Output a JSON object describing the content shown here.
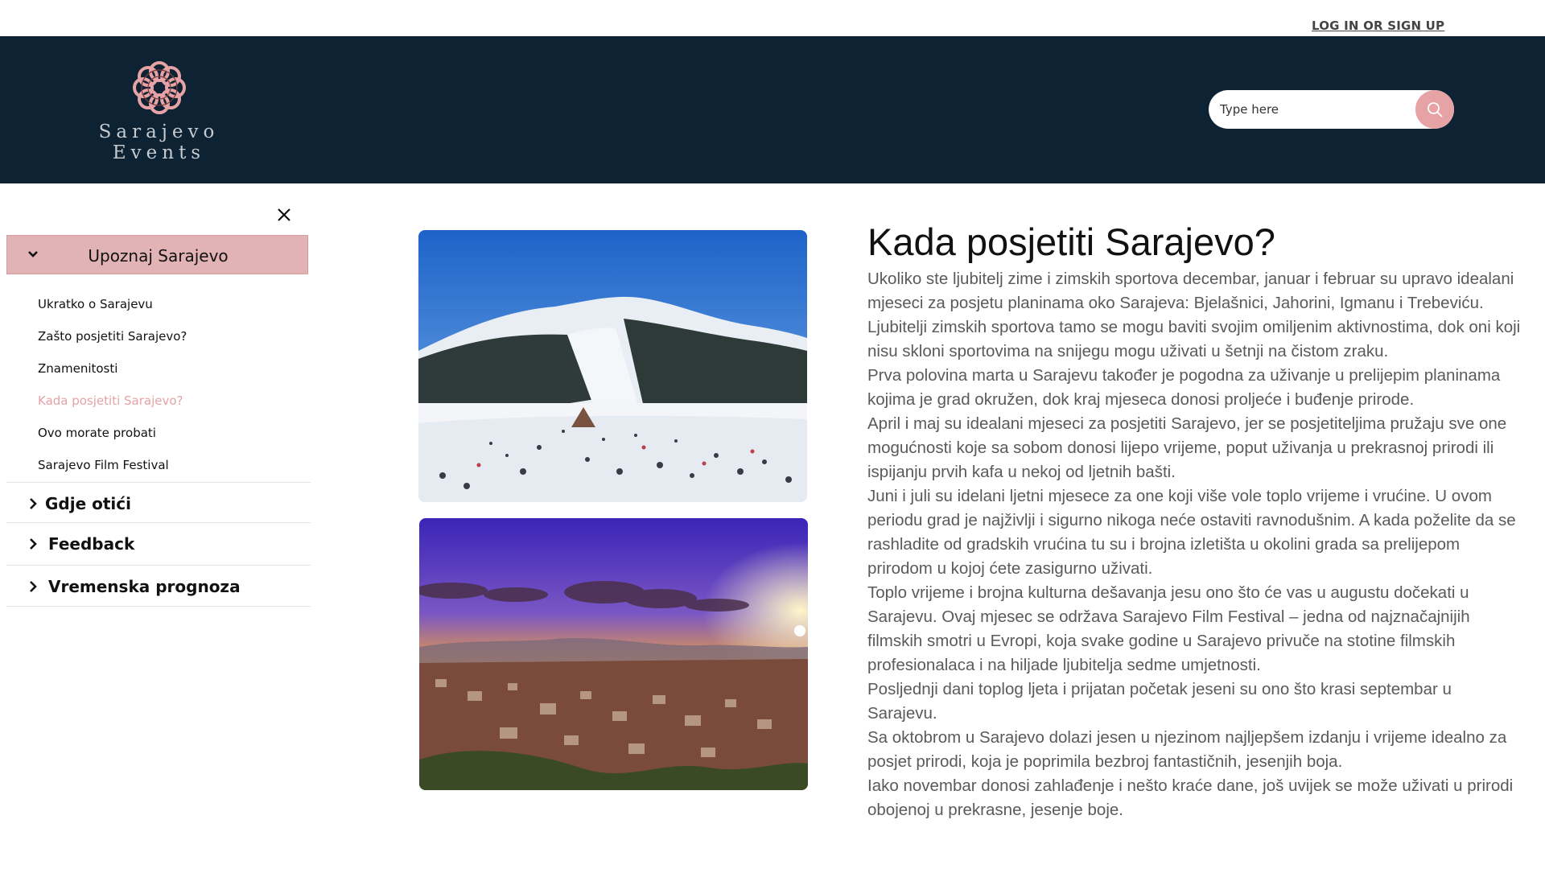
{
  "auth": {
    "login_label": "LOG IN OR SIGN UP"
  },
  "brand": {
    "line1": "Sarajevo",
    "line2": "Events",
    "accent_color": "#e6a2a4",
    "header_bg": "#0d2233"
  },
  "search": {
    "placeholder": "Type here",
    "button_icon": "search-icon"
  },
  "sidebar": {
    "close_icon": "close-icon",
    "active_section": {
      "label": "Upoznaj Sarajevo",
      "items": [
        {
          "label": "Ukratko o Sarajevu",
          "active": false
        },
        {
          "label": "Zašto posjetiti Sarajevo?",
          "active": false
        },
        {
          "label": "Znamenitosti",
          "active": false
        },
        {
          "label": "Kada posjetiti Sarajevo?",
          "active": true
        },
        {
          "label": "Ovo morate probati",
          "active": false
        },
        {
          "label": "Sarajevo Film Festival",
          "active": false
        }
      ]
    },
    "sections": [
      {
        "label": "Gdje otići"
      },
      {
        "label": "Feedback"
      },
      {
        "label": "Vremenska prognoza"
      }
    ]
  },
  "main": {
    "title": "Kada posjetiti Sarajevo?",
    "paragraphs": [
      "Ukoliko ste ljubitelj zime i zimskih sportova decembar, januar i februar su upravo idealani mjeseci za posjetu planinama oko Sarajeva: Bjelašnici, Jahorini, Igmanu i Trebeviću. Ljubitelji zimskih sportova tamo se mogu baviti svojim omiljenim aktivnostima, dok oni koji nisu skloni sportovima na snijegu mogu uživati u šetnji na čistom zraku.",
      "Prva polovina marta u Sarajevu također je pogodna za uživanje u prelijepim planinama kojima je grad okružen, dok kraj mjeseca donosi proljeće i buđenje prirode.",
      "April i maj su idealani mjeseci za posjetiti Sarajevo, jer se posjetiteljima pružaju sve one mogućnosti koje sa sobom donosi lijepo vrijeme, poput uživanja u prekrasnoj prirodi ili ispijanju prvih kafa u nekoj od ljetnih bašti.",
      "Juni i juli su idelani ljetni mjesece za one koji više vole toplo vrijeme i vrućine. U ovom periodu grad je najživlji i sigurno nikoga neće ostaviti ravnodušnim. A kada poželite da se rashladite od gradskih vrućina tu su i brojna izletišta u okolini grada sa prelijepom prirodom u kojoj ćete zasigurno uživati.",
      "Toplo vrijeme i brojna kulturna dešavanja jesu ono što će vas u augustu dočekati u Sarajevu. Ovaj mjesec se održava Sarajevo Film Festival – jedna od najznačajnijih filmskih smotri u Evropi, koja svake godine u Sarajevo privuče na stotine filmskih profesionalaca i na hiljade ljubitelja sedme umjetnosti.",
      "Posljednji dani toplog ljeta i prijatan početak jeseni su ono što krasi septembar u Sarajevu.",
      "Sa oktobrom u Sarajevo dolazi jesen u njezinom najljepšem izdanju i vrijeme idealno za posjet prirodi, koja je poprimila bezbroj fantastičnih, jesenjih boja.",
      "Iako novembar donosi zahlađenje i nešto kraće dane, još uvijek se može uživati u prirodi obojenoj u prekrasne, jesenje boje."
    ]
  }
}
